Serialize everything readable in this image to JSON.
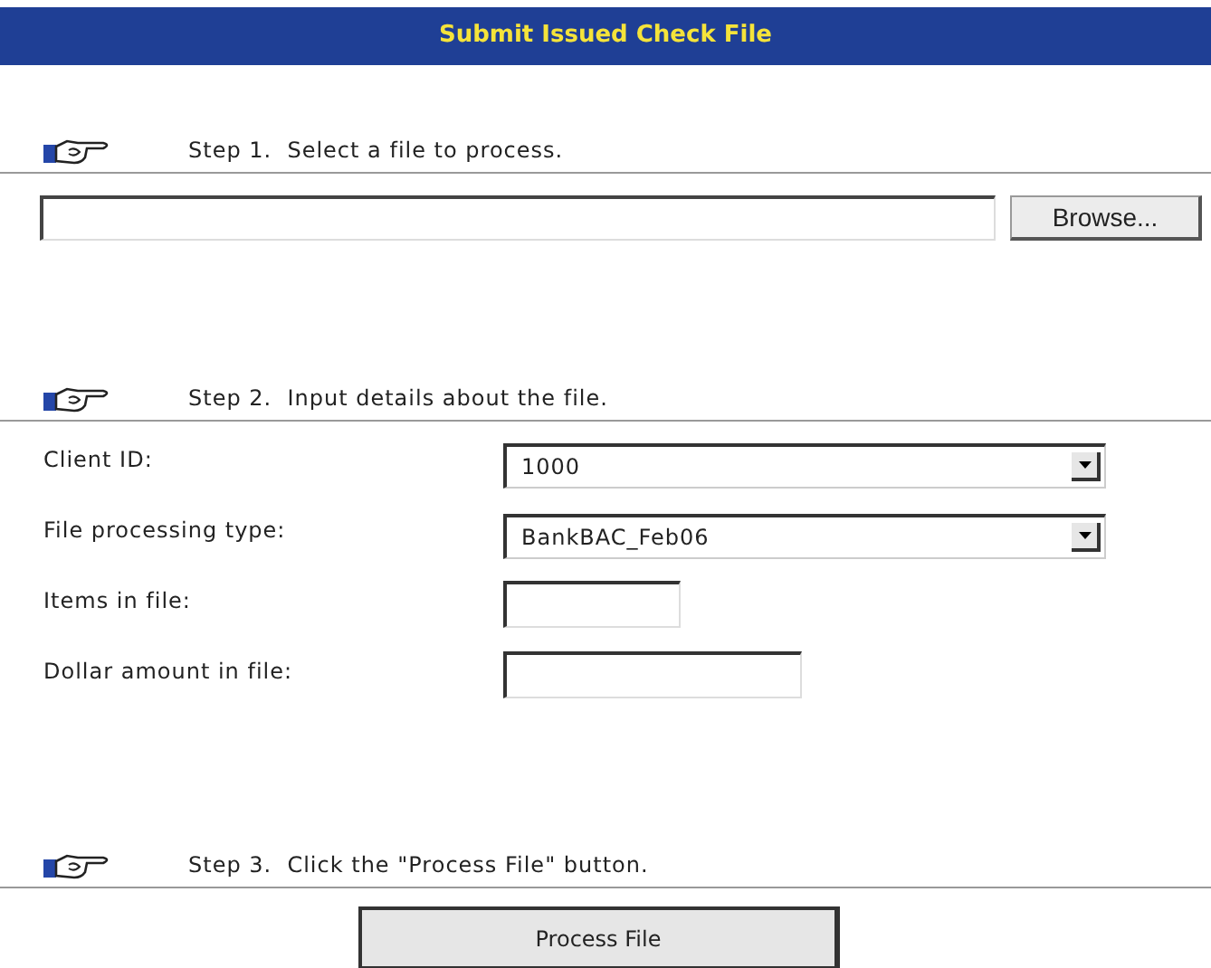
{
  "title": "Submit Issued Check File",
  "step_1": {
    "text": "Step 1.  Select a file to process.",
    "file_field": {
      "button": "Browse..."
    }
  },
  "step_2": {
    "text": "Step 2.  Input details about the file.",
    "fields": [
      {
        "label": "Client ID:",
        "kind": "select",
        "value": "1000"
      },
      {
        "label": "File processing type:",
        "kind": "select",
        "value": "BankBAC_Feb06"
      },
      {
        "label": "Items in file:",
        "kind": "count"
      },
      {
        "label": "Dollar amount in file:",
        "kind": "amount"
      }
    ]
  },
  "step_3": {
    "text": "Step 3.  Click the \"Process File\" button.",
    "button": "Process File"
  }
}
